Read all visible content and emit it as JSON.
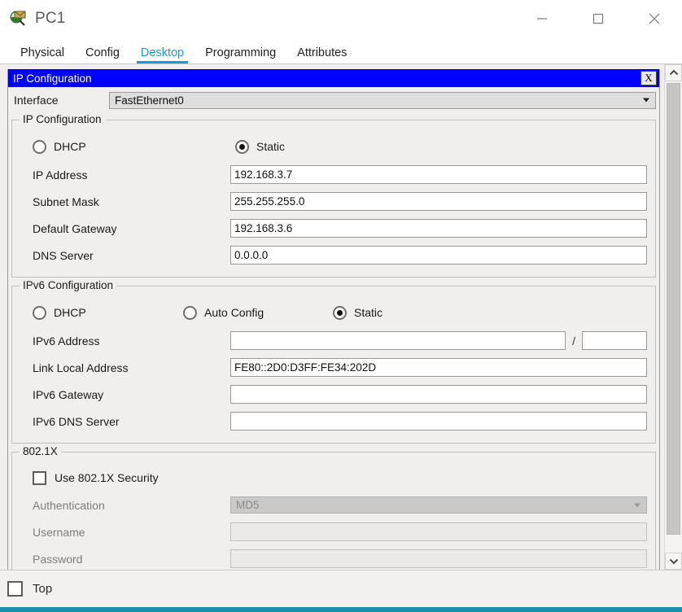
{
  "window": {
    "title": "PC1",
    "icon": "pc-magnifier-icon",
    "controls": {
      "minimize": "minimize-icon",
      "maximize": "maximize-icon",
      "close": "close-icon"
    }
  },
  "tabs": [
    {
      "label": "Physical",
      "active": false
    },
    {
      "label": "Config",
      "active": false
    },
    {
      "label": "Desktop",
      "active": true
    },
    {
      "label": "Programming",
      "active": false
    },
    {
      "label": "Attributes",
      "active": false
    }
  ],
  "dialog": {
    "title": "IP Configuration",
    "close_label": "X",
    "titlebar_color": "#0000ff",
    "interface": {
      "label": "Interface",
      "value": "FastEthernet0"
    },
    "ipv4": {
      "group_title": "IP Configuration",
      "mode_dhcp": "DHCP",
      "mode_static": "Static",
      "selected_mode": "Static",
      "fields": [
        {
          "label": "IP Address",
          "value": "192.168.3.7"
        },
        {
          "label": "Subnet Mask",
          "value": "255.255.255.0"
        },
        {
          "label": "Default Gateway",
          "value": "192.168.3.6"
        },
        {
          "label": "DNS Server",
          "value": "0.0.0.0"
        }
      ]
    },
    "ipv6": {
      "group_title": "IPv6 Configuration",
      "mode_dhcp": "DHCP",
      "mode_auto": "Auto Config",
      "mode_static": "Static",
      "selected_mode": "Static",
      "address_label": "IPv6 Address",
      "address_value": "",
      "prefix_separator": "/",
      "prefix_value": "",
      "fields": [
        {
          "label": "Link Local Address",
          "value": "FE80::2D0:D3FF:FE34:202D"
        },
        {
          "label": "IPv6 Gateway",
          "value": ""
        },
        {
          "label": "IPv6 DNS Server",
          "value": ""
        }
      ]
    },
    "dot1x": {
      "group_title": "802.1X",
      "use_security_label": "Use 802.1X Security",
      "use_security_checked": false,
      "authentication_label": "Authentication",
      "authentication_value": "MD5",
      "username_label": "Username",
      "username_value": "",
      "password_label": "Password",
      "password_value": ""
    }
  },
  "scrollbar": {
    "up": "chevron-up-icon",
    "down": "chevron-down-icon"
  },
  "footer": {
    "top_label": "Top",
    "top_checked": false,
    "accent_color": "#1b8fa8"
  }
}
